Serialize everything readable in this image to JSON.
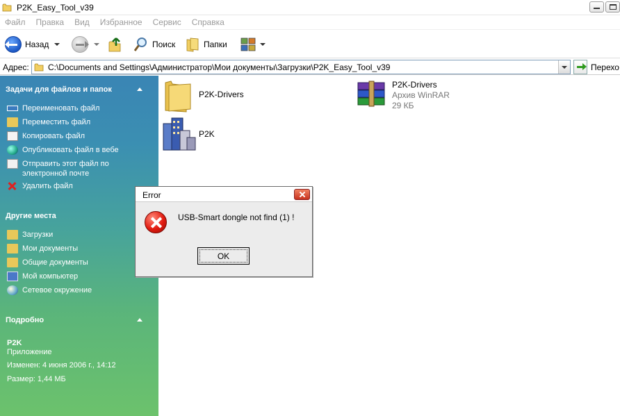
{
  "window": {
    "title": "P2K_Easy_Tool_v39",
    "controls": [
      "minimize",
      "maximize"
    ]
  },
  "menu": [
    "Файл",
    "Правка",
    "Вид",
    "Избранное",
    "Сервис",
    "Справка"
  ],
  "toolbar": {
    "back": "Назад",
    "search": "Поиск",
    "folders": "Папки"
  },
  "address": {
    "label": "Адрес:",
    "path": "C:\\Documents and Settings\\Администратор\\Мои документы\\Загрузки\\P2K_Easy_Tool_v39",
    "go": "Перехо"
  },
  "sidepane": {
    "tasks_title": "Задачи для файлов и папок",
    "tasks": [
      {
        "label": "Переименовать файл",
        "icon": "rename-icon"
      },
      {
        "label": "Переместить файл",
        "icon": "move-icon"
      },
      {
        "label": "Копировать файл",
        "icon": "copy-icon"
      },
      {
        "label": "Опубликовать файл в вебе",
        "icon": "globe-icon"
      },
      {
        "label": "Отправить этот файл по электронной почте",
        "icon": "mail-icon"
      },
      {
        "label": "Удалить файл",
        "icon": "delete-icon"
      }
    ],
    "places_title": "Другие места",
    "places": [
      {
        "label": "Загрузки",
        "icon": "folder-icon"
      },
      {
        "label": "Мои документы",
        "icon": "folder-icon"
      },
      {
        "label": "Общие документы",
        "icon": "folder-icon"
      },
      {
        "label": "Мой компьютер",
        "icon": "computer-icon"
      },
      {
        "label": "Сетевое окружение",
        "icon": "network-icon"
      }
    ],
    "details_title": "Подробно",
    "details": {
      "name": "P2K",
      "type": "Приложение",
      "modified": "Изменен: 4 июня 2006 г., 14:12",
      "size": "Размер: 1,44 МБ"
    }
  },
  "files": [
    {
      "name": "P2K-Drivers",
      "icon": "folder-icon"
    },
    {
      "name": "P2K-Drivers",
      "type": "Архив WinRAR",
      "size": "29 КБ",
      "icon": "winrar-archive-icon"
    },
    {
      "name": "P2K",
      "icon": "application-icon"
    }
  ],
  "dialog": {
    "title": "Error",
    "message": "USB-Smart dongle not find (1) !",
    "ok": "OK",
    "icon": "error-icon"
  }
}
